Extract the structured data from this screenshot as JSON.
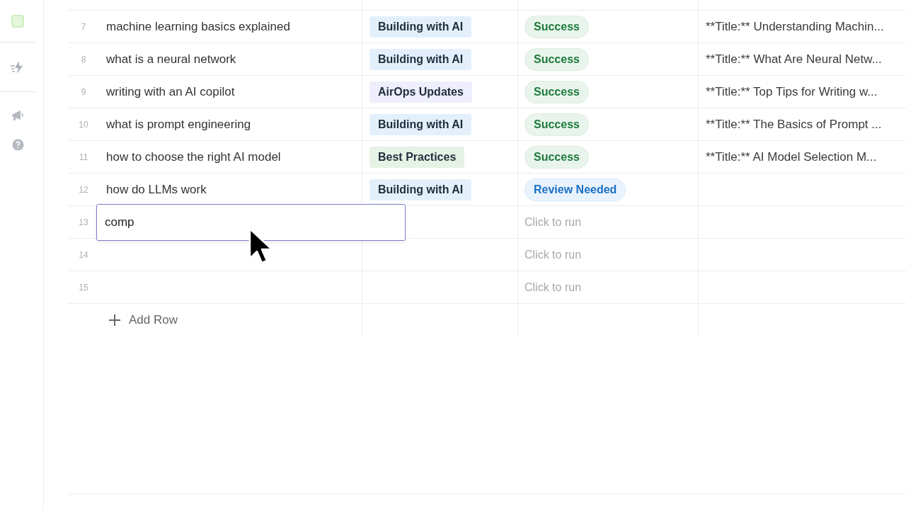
{
  "rows": [
    {
      "number": "7",
      "query": "machine learning basics explained",
      "category": {
        "label": "Building with AI",
        "color": "#e3f0fc"
      },
      "status": {
        "kind": "success",
        "label": "Success"
      },
      "output": "**Title:** Understanding Machin..."
    },
    {
      "number": "8",
      "query": "what is a neural network",
      "category": {
        "label": "Building with AI",
        "color": "#e3f0fc"
      },
      "status": {
        "kind": "success",
        "label": "Success"
      },
      "output": "**Title:** What Are Neural Netw..."
    },
    {
      "number": "9",
      "query": "writing with an AI copilot",
      "category": {
        "label": "AirOps Updates",
        "color": "#eeeefc"
      },
      "status": {
        "kind": "success",
        "label": "Success"
      },
      "output": "**Title:** Top Tips for Writing w..."
    },
    {
      "number": "10",
      "query": "what is prompt engineering",
      "category": {
        "label": "Building with AI",
        "color": "#e3f0fc"
      },
      "status": {
        "kind": "success",
        "label": "Success"
      },
      "output": "**Title:** The Basics of Prompt ..."
    },
    {
      "number": "11",
      "query": "how to choose the right AI model",
      "category": {
        "label": "Best Practices",
        "color": "#e6f2e6"
      },
      "status": {
        "kind": "success",
        "label": "Success"
      },
      "output": "**Title:** AI Model Selection M..."
    },
    {
      "number": "12",
      "query": "how do LLMs work",
      "category": {
        "label": "Building with AI",
        "color": "#e3f0fc"
      },
      "status": {
        "kind": "review",
        "label": "Review Needed"
      }
    },
    {
      "number": "13",
      "query": "comp",
      "editing": true,
      "status": {
        "kind": "run",
        "label": "Click to run"
      }
    },
    {
      "number": "14",
      "editing": false,
      "status": {
        "kind": "run",
        "label": "Click to run"
      }
    },
    {
      "number": "15",
      "editing": false,
      "status": {
        "kind": "run",
        "label": "Click to run"
      }
    }
  ],
  "add_row": "Add Row"
}
